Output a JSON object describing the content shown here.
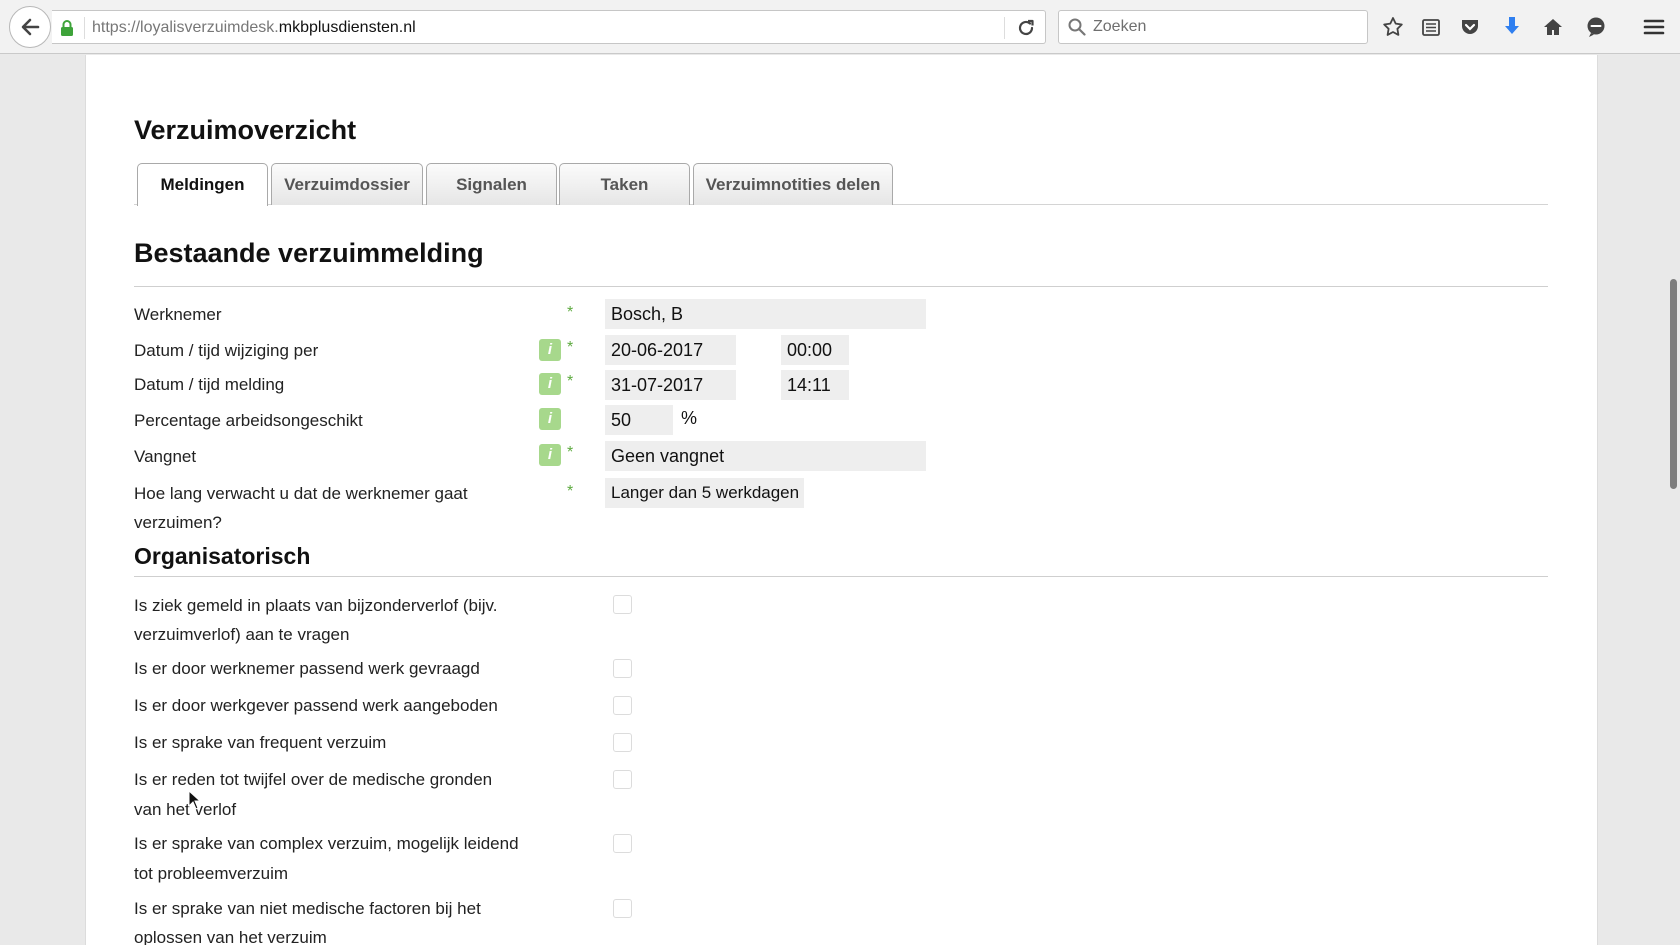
{
  "browser": {
    "url_prefix": "https://loyalisverzuimdesk.",
    "url_domain": "mkbplusdiensten.nl",
    "search_placeholder": "Zoeken"
  },
  "page": {
    "title": "Verzuimoverzicht",
    "tabs": [
      {
        "label": "Meldingen",
        "active": true
      },
      {
        "label": "Verzuimdossier",
        "active": false
      },
      {
        "label": "Signalen",
        "active": false
      },
      {
        "label": "Taken",
        "active": false
      },
      {
        "label": "Verzuimnotities delen",
        "active": false
      }
    ]
  },
  "form": {
    "section_title": "Bestaande verzuimmelding",
    "info_glyph": "i",
    "required_mark": "*",
    "fields": {
      "werknemer": {
        "label": "Werknemer",
        "value": "Bosch, B"
      },
      "datum_wijziging": {
        "label": "Datum / tijd wijziging per",
        "date": "20-06-2017",
        "time": "00:00"
      },
      "datum_melding": {
        "label": "Datum / tijd melding",
        "date": "31-07-2017",
        "time": "14:11"
      },
      "percentage": {
        "label": "Percentage arbeidsongeschikt",
        "value": "50",
        "unit": "%"
      },
      "vangnet": {
        "label": "Vangnet",
        "value": "Geen vangnet"
      },
      "duur": {
        "label_line1": "Hoe lang verwacht u dat de werknemer gaat",
        "label_line2": "verzuimen?",
        "value": "Langer dan 5 werkdagen"
      }
    }
  },
  "organisatorisch": {
    "section_title": "Organisatorisch",
    "items": [
      {
        "line1": "Is ziek gemeld in plaats van bijzonderverlof (bijv.",
        "line2": "verzuimverlof) aan te vragen",
        "checked": false
      },
      {
        "line1": "Is er door werknemer passend werk gevraagd",
        "line2": "",
        "checked": false
      },
      {
        "line1": "Is er door werkgever passend werk aangeboden",
        "line2": "",
        "checked": false
      },
      {
        "line1": "Is er sprake van frequent verzuim",
        "line2": "",
        "checked": false
      },
      {
        "line1": "Is er reden tot twijfel over de medische gronden",
        "line2": "van het verlof",
        "checked": false
      },
      {
        "line1": "Is er sprake van complex verzuim, mogelijk leidend",
        "line2": "tot probleemverzuim",
        "checked": false
      },
      {
        "line1": "Is er sprake van niet medische factoren bij het",
        "line2": "oplossen van het verzuim",
        "checked": false
      }
    ]
  }
}
